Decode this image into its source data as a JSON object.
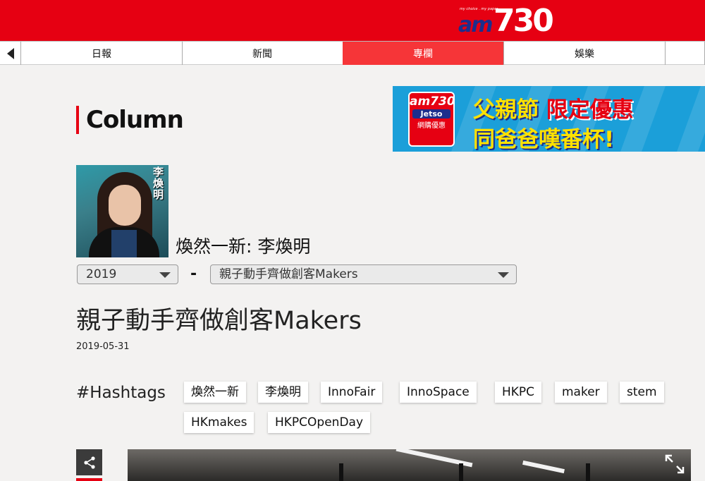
{
  "header": {
    "logo_tagline": "my choice . my paper",
    "logo_am": "am",
    "logo_num": "730"
  },
  "nav": {
    "tabs": [
      {
        "label": "日報"
      },
      {
        "label": "新聞"
      },
      {
        "label": "專欄",
        "active": true
      },
      {
        "label": "娛樂"
      }
    ]
  },
  "page": {
    "section_title": "Column"
  },
  "banner": {
    "badge_line1": "am730",
    "badge_line2": "Jetso",
    "badge_line3": "網購優惠",
    "headline_part1": "父親節",
    "headline_part2": "限定優惠",
    "headline_line2": "同爸爸嘆番杯!"
  },
  "author": {
    "photo_name": "李煥明",
    "column_name": "煥然一新: 李煥明"
  },
  "filters": {
    "year_selected": "2019",
    "separator": "-",
    "article_selected": "親子動手齊做創客Makers"
  },
  "article": {
    "title": "親子動手齊做創客Makers",
    "date": "2019-05-31"
  },
  "hashtags": {
    "label": "#Hashtags",
    "tags": [
      "煥然一新",
      "李煥明",
      "InnoFair",
      "InnoSpace",
      "HKPC",
      "maker",
      "stem",
      "HKmakes",
      "HKPCOpenDay"
    ]
  },
  "colors": {
    "brand_red": "#e60012",
    "active_tab": "#f63538",
    "logo_blue": "#1d2e8c",
    "banner_blue": "#1b9fd9",
    "banner_yellow": "#ffe100"
  },
  "icons": {
    "back": "chevron-left-icon",
    "share": "share-icon",
    "expand": "expand-icon",
    "dropdown": "caret-down-icon"
  }
}
